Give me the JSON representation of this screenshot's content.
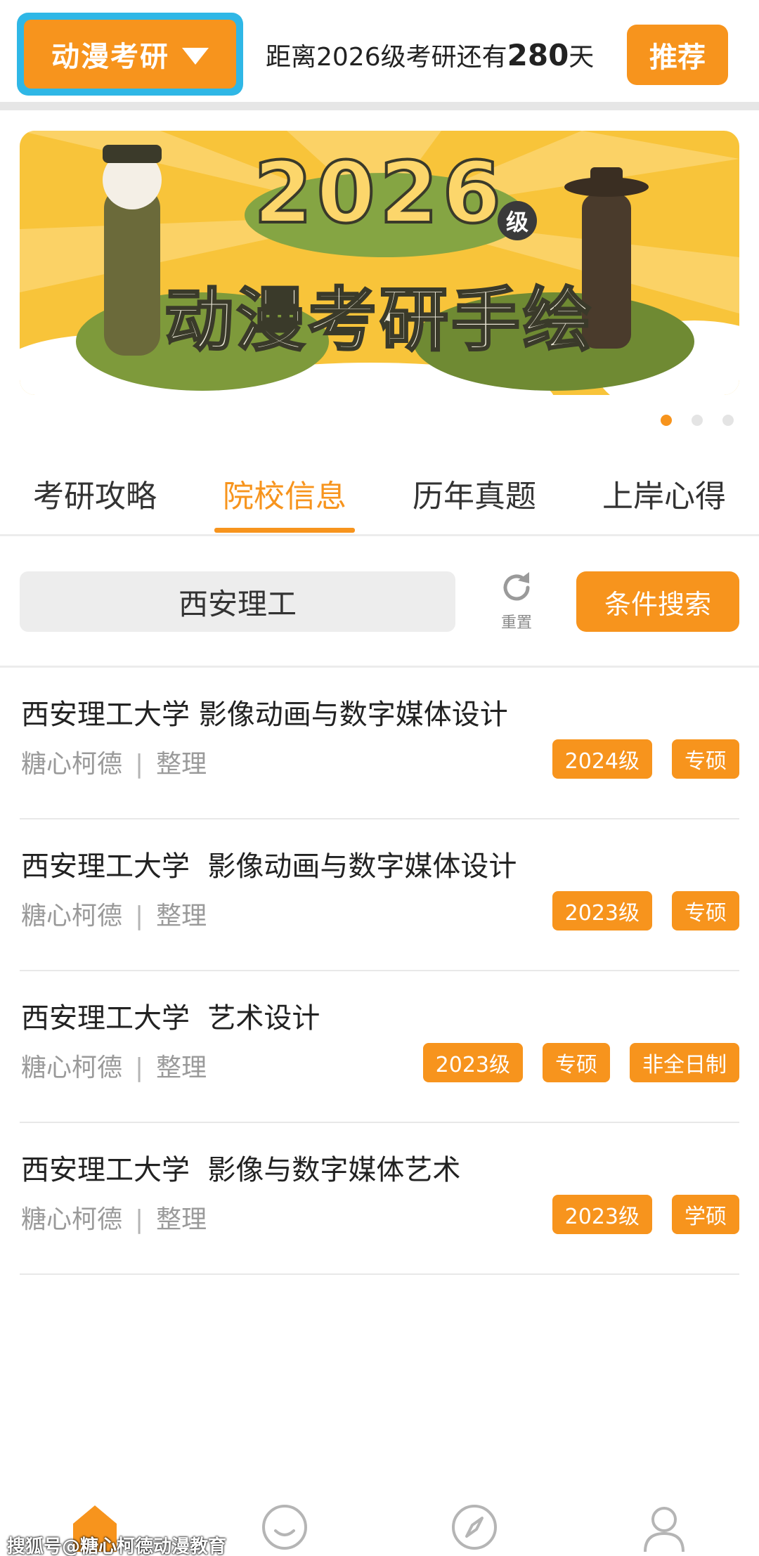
{
  "header": {
    "category_label": "动漫考研",
    "countdown_prefix": "距离2026级考研还有",
    "countdown_days": "280",
    "countdown_suffix": "天",
    "recommend_label": "推荐"
  },
  "banner": {
    "year": "2026",
    "grade_badge": "级",
    "title": "动漫考研手绘",
    "page_count": 3,
    "active_index": 0
  },
  "tabs": [
    {
      "label": "考研攻略",
      "active": false
    },
    {
      "label": "院校信息",
      "active": true
    },
    {
      "label": "历年真题",
      "active": false
    },
    {
      "label": "上岸心得",
      "active": false
    }
  ],
  "search": {
    "value": "西安理工",
    "reset_label": "重置",
    "submit_label": "条件搜索"
  },
  "results": [
    {
      "title": "西安理工大学 影像动画与数字媒体设计",
      "author": "糖心柯德",
      "sep": "|",
      "role": "整理",
      "tags": [
        "2024级",
        "专硕"
      ]
    },
    {
      "title": "西安理工大学  影像动画与数字媒体设计",
      "author": "糖心柯德",
      "sep": "|",
      "role": "整理",
      "tags": [
        "2023级",
        "专硕"
      ]
    },
    {
      "title": "西安理工大学  艺术设计",
      "author": "糖心柯德",
      "sep": "|",
      "role": "整理",
      "tags": [
        "2023级",
        "专硕",
        "非全日制"
      ]
    },
    {
      "title": "西安理工大学  影像与数字媒体艺术",
      "author": "糖心柯德",
      "sep": "|",
      "role": "整理",
      "tags": [
        "2023级",
        "学硕"
      ]
    }
  ],
  "bottom_nav": [
    {
      "icon": "home-icon"
    },
    {
      "icon": "smile-icon"
    },
    {
      "icon": "compass-icon"
    },
    {
      "icon": "user-icon"
    }
  ],
  "watermark": "搜狐号@糖心柯德动漫教育",
  "colors": {
    "accent": "#f7941d",
    "category_frame": "#2fb7e6",
    "banner_bg": "#f8c43a"
  }
}
